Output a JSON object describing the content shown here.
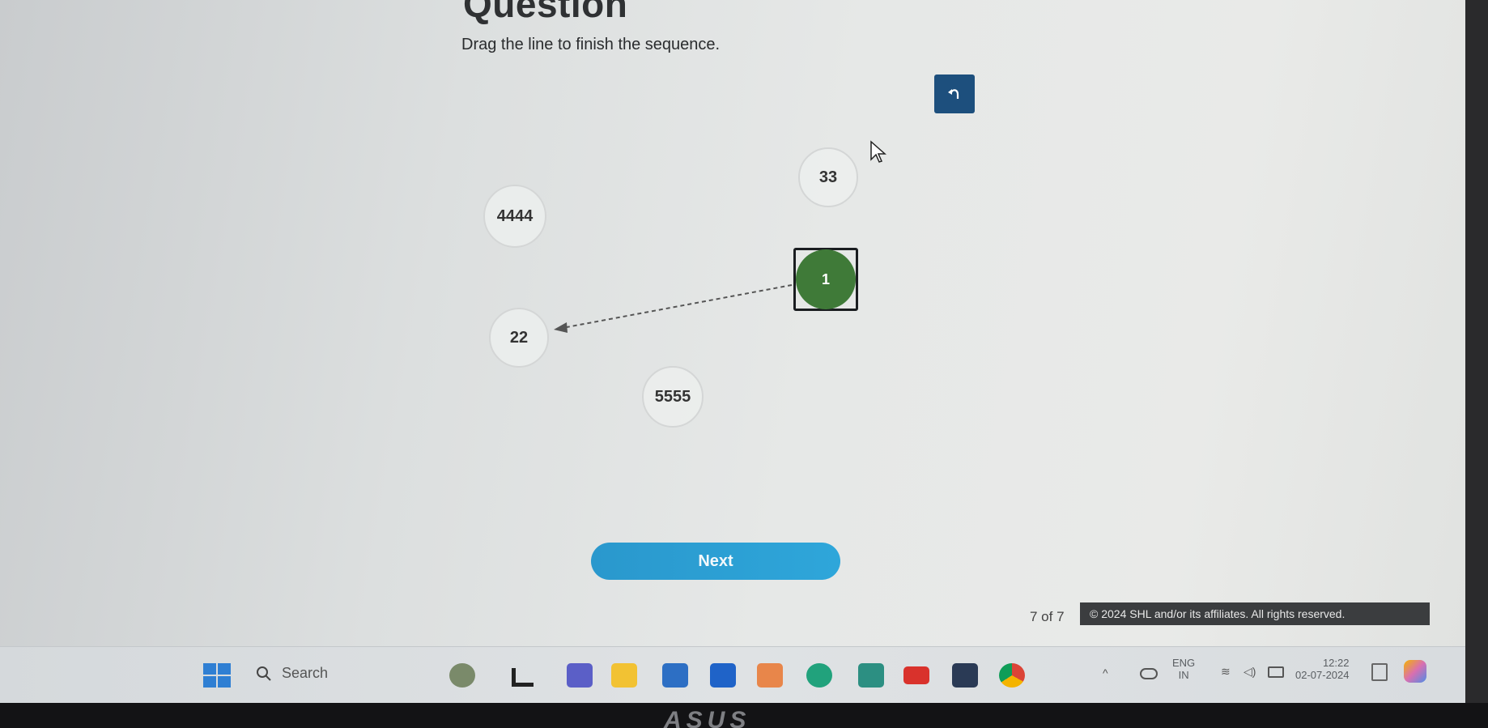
{
  "question": {
    "title": "Question",
    "prompt": "Drag the line to finish the sequence."
  },
  "nodes": [
    {
      "id": "node-33",
      "label": "33"
    },
    {
      "id": "node-4444",
      "label": "4444"
    },
    {
      "id": "node-1",
      "label": "1",
      "state": "selected"
    },
    {
      "id": "node-22",
      "label": "22"
    },
    {
      "id": "node-5555",
      "label": "5555"
    }
  ],
  "connection": {
    "from": "1",
    "to": "22"
  },
  "next_label": "Next",
  "footer": {
    "progress": "7 of 7",
    "copyright": "© 2024 SHL and/or its affiliates. All rights reserved."
  },
  "taskbar": {
    "search_placeholder": "Search",
    "lang_top": "ENG",
    "lang_bottom": "IN",
    "time": "12:22",
    "date": "02-07-2024"
  },
  "laptop_logo": "ASUS",
  "colors": {
    "selected_node": "#3f7a38",
    "undo_button": "#1d4f7d",
    "next_button": "#2a98cd"
  }
}
